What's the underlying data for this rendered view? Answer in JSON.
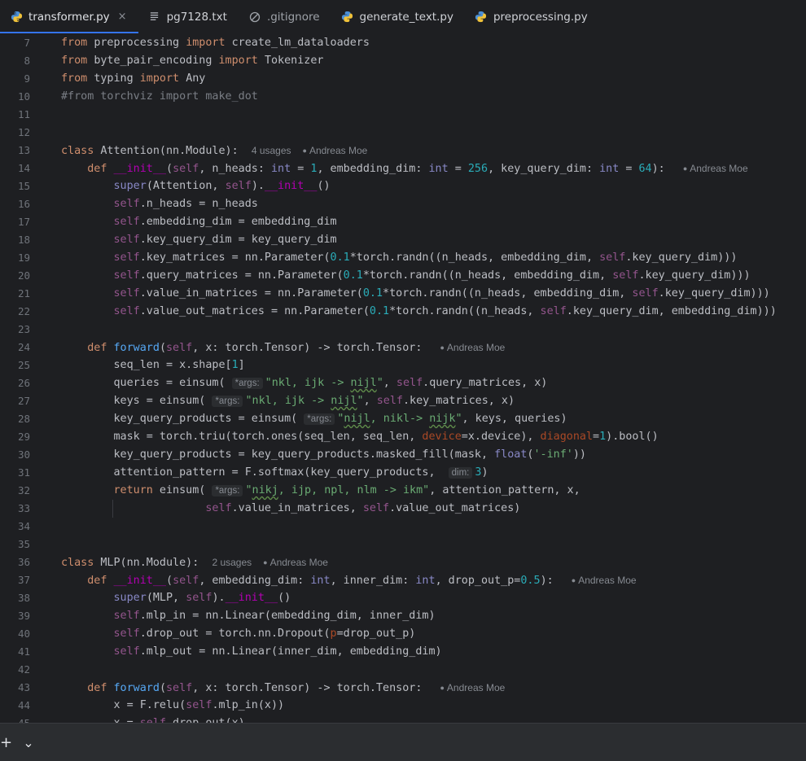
{
  "tabs": [
    {
      "label": "transformer.py",
      "icon": "python-icon",
      "active": true,
      "close": "×"
    },
    {
      "label": "pg7128.txt",
      "icon": "text-file-icon"
    },
    {
      "label": ".gitignore",
      "icon": "ignore-file-icon"
    },
    {
      "label": "generate_text.py",
      "icon": "python-icon"
    },
    {
      "label": "preprocessing.py",
      "icon": "python-icon"
    }
  ],
  "code": {
    "l7_mod": "preprocessing",
    "l7_name": "create_lm_dataloaders",
    "l8_mod": "byte_pair_encoding",
    "l8_name": "Tokenizer",
    "l9_mod": "typing",
    "l9_name": "Any",
    "l10": "#from torchviz import make_dot",
    "attn_class": "Attention(nn.Module):",
    "attn_usages": "4 usages",
    "author": "Andreas Moe",
    "mlp_class": "MLP(nn.Module):",
    "mlp_usages": "2 usages"
  },
  "hints": {
    "args": "*args:",
    "dim": "dim:"
  },
  "bottom": {
    "add": "+",
    "chevron": "⌄"
  }
}
